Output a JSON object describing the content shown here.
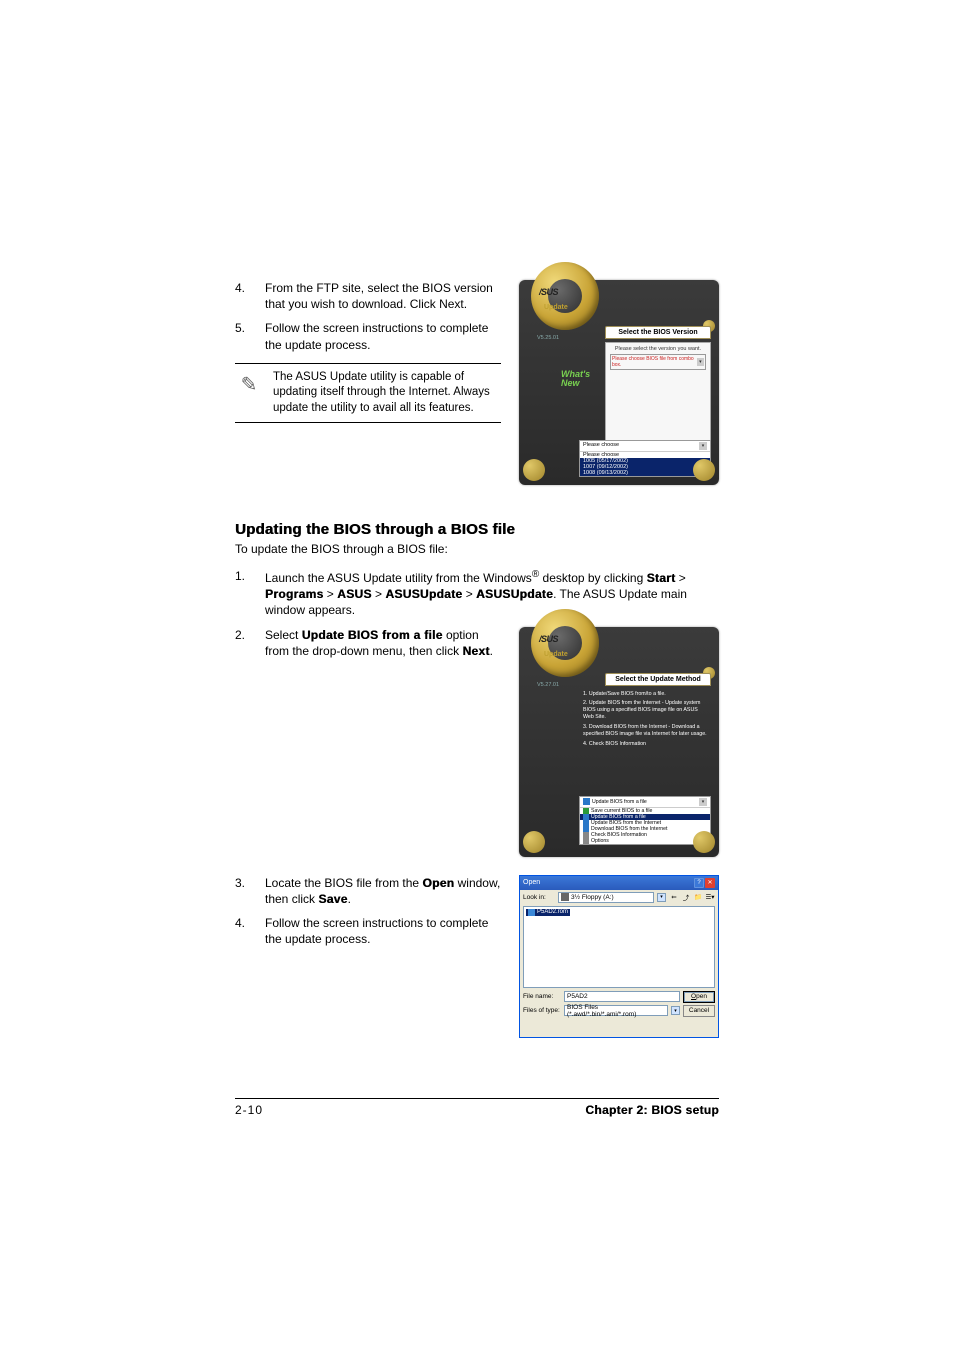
{
  "steps_top": {
    "s4_num": "4.",
    "s4": "From the FTP site, select the BIOS version that you wish to download. Click Next.",
    "s5_num": "5.",
    "s5": "Follow the screen instructions to complete the update process."
  },
  "note": "The ASUS Update utility is capable of updating itself through the Internet. Always update the utility to avail all its features.",
  "win1": {
    "logo": "/SUS",
    "update": "Update",
    "version": "V5.25.01",
    "whats1": "What's",
    "whats2": "New",
    "panel_title": "Select the BIOS Version",
    "body_text": "Please select the version you want.",
    "combo_text": "Please choose BIOS file from combo box.",
    "dd_top": "Please choose",
    "dd_items": [
      "Please choose",
      "1005 (05/17/2002)",
      "1007 (09/12/2002)",
      "1008 (09/13/2002)"
    ]
  },
  "heading": "Updating the BIOS through a BIOS file",
  "heading_sub": "To update the BIOS through a BIOS file:",
  "steps_mid": {
    "s1_num": "1.",
    "s1_a": "Launch the ASUS Update utility from the Windows",
    "s1_reg": "®",
    "s1_b": " desktop by clicking ",
    "s1_start": "Start",
    "s1_gt1": " > ",
    "s1_programs": "Programs",
    "s1_gt2": " > ",
    "s1_asus": "ASUS",
    "s1_gt3": " > ",
    "s1_asusupdate": "ASUSUpdate",
    "s1_gt4": " > ",
    "s1_asusupdate2": "ASUSUpdate",
    "s1_c": ". The ASUS Update main window appears.",
    "s2_num": "2.",
    "s2_a": "Select ",
    "s2_b": "Update BIOS from a file",
    "s2_c": " option from the drop-down menu, then click ",
    "s2_next": "Next",
    "s2_d": "."
  },
  "win2": {
    "logo": "/SUS",
    "update": "Update",
    "version": "V5.27.01",
    "panel_title": "Select the Update Method",
    "m1": "1. Update/Save BIOS from/to a file.",
    "m2": "2. Update BIOS from the Internet - Update system BIOS using a specified BIOS image file on ASUS Web Site.",
    "m3": "3. Download BIOS from the Internet - Download a specified BIOS image file via Internet for later usage.",
    "m4": "4. Check BIOS Information",
    "sel_top": "Update BIOS from a file",
    "opts": [
      "Save current BIOS to a file",
      "Update BIOS from a file",
      "Update BIOS from the Internet",
      "Download BIOS from the Internet",
      "Check BIOS Information",
      "Options"
    ]
  },
  "steps_bot": {
    "s3_num": "3.",
    "s3_a": "Locate the BIOS file from the ",
    "s3_open": "Open",
    "s3_b": " window, then click ",
    "s3_save": "Save",
    "s3_c": ".",
    "s4_num": "4.",
    "s4": "Follow the screen instructions to complete the update process."
  },
  "open_dialog": {
    "title": "Open",
    "lookin_lbl": "Look in:",
    "lookin_val": "3½ Floppy (A:)",
    "file_item": "P5AD2.rom",
    "fn_lbl": "File name:",
    "fn_val": "P5AD2",
    "ft_lbl": "Files of type:",
    "ft_val": "BIOS Files (*.awd/*.bin/*.ami/*.rom)",
    "btn_open": "Open",
    "btn_cancel": "Cancel"
  },
  "footer": {
    "page": "2-10",
    "chapter": "Chapter 2: BIOS setup"
  }
}
